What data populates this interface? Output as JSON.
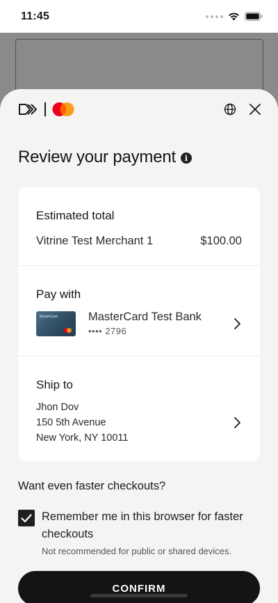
{
  "status_bar": {
    "time": "11:45"
  },
  "header": {
    "brand": "Click to Pay / Mastercard"
  },
  "page": {
    "title": "Review your payment"
  },
  "total": {
    "title": "Estimated total",
    "merchant": "Vitrine Test Merchant 1",
    "amount": "$100.00"
  },
  "payment": {
    "title": "Pay with",
    "card_art_text": "MasterCard",
    "bank": "MasterCard Test Bank",
    "card_number": "•••• 2796"
  },
  "shipping": {
    "title": "Ship to",
    "name": "Jhon Dov",
    "street": "150 5th Avenue",
    "city": "New York, NY 10011"
  },
  "faster": {
    "heading": "Want even faster checkouts?",
    "remember_label": "Remember me in this browser for faster checkouts",
    "remember_note": "Not recommended for public or shared devices.",
    "checked": true
  },
  "actions": {
    "confirm": "CONFIRM"
  },
  "colors": {
    "mastercard_red": "#eb001b",
    "mastercard_orange": "#f79e1b",
    "sheet_bg": "#f5f4f2",
    "button": "#141414"
  },
  "icons": [
    "click-to-pay-logo-icon",
    "mastercard-logo-icon",
    "globe-icon",
    "close-icon",
    "info-icon",
    "chevron-right-icon",
    "check-icon"
  ]
}
